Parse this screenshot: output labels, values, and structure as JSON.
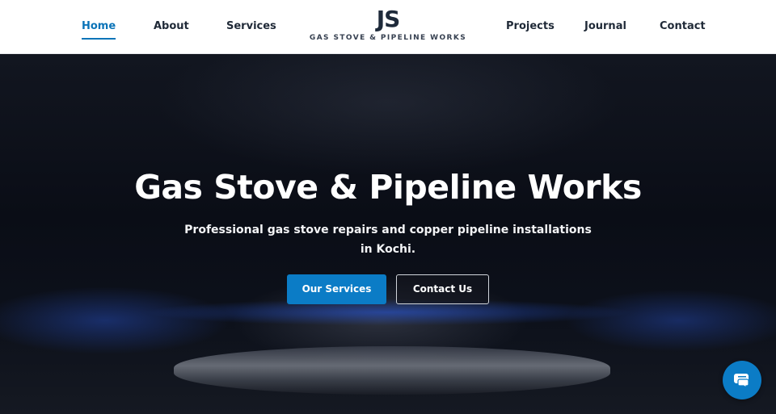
{
  "nav": {
    "left": [
      {
        "label": "Home",
        "active": true
      },
      {
        "label": "About"
      },
      {
        "label": "Services"
      }
    ],
    "right": [
      {
        "label": "Projects"
      },
      {
        "label": "Journal"
      },
      {
        "label": "Contact"
      }
    ]
  },
  "logo": {
    "mark": "JS",
    "tagline": "GAS STOVE & PIPELINE WORKS"
  },
  "hero": {
    "title": "Gas Stove & Pipeline Works",
    "subtitle": "Professional gas stove repairs and copper pipeline installations in Kochi.",
    "primary_button": "Our Services",
    "secondary_button": "Contact Us"
  },
  "chat": {
    "icon": "chat-icon"
  },
  "colors": {
    "accent": "#0b7cc6",
    "nav_active": "#0b74b8",
    "nav_text": "#1f2937",
    "header_bg": "#ffffff"
  }
}
